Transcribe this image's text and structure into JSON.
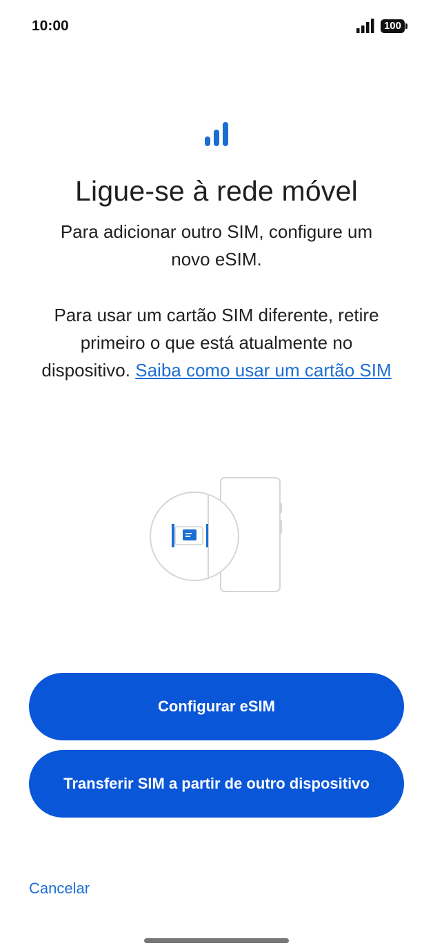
{
  "status_bar": {
    "time": "10:00",
    "battery": "100",
    "signal_icon": "cellular-signal-icon"
  },
  "hero": {
    "icon": "cellular-signal-icon",
    "accent_color": "#1b6ed3"
  },
  "title": "Ligue-se à rede móvel",
  "paragraph1": "Para adicionar outro SIM, configure um novo eSIM.",
  "paragraph2": {
    "text": "Para usar um cartão SIM diferente, retire primeiro o que está atualmente no dispositivo.",
    "link": "Saiba como usar um cartão SIM"
  },
  "illustration": {
    "icon": "sim-card-tray-icon"
  },
  "buttons": {
    "configure_esim": "Configurar eSIM",
    "transfer_sim": "Transferir SIM a partir de outro dispositivo",
    "color": "#0a56d8"
  },
  "cancel": "Cancelar"
}
